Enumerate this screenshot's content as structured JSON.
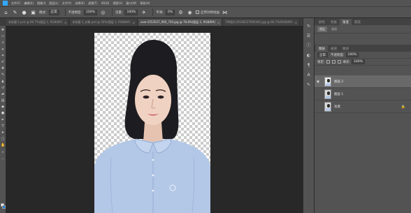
{
  "menubar": {
    "items": [
      "文件(F)",
      "编辑(E)",
      "图像(I)",
      "图层(L)",
      "文字(Y)",
      "选择(S)",
      "滤镜(T)",
      "3D(D)",
      "视图(V)",
      "窗口(W)",
      "帮助(H)"
    ]
  },
  "options": {
    "mode_label": "模式:",
    "mode_value": "正常",
    "opacity_label": "不透明度:",
    "opacity_value": "100%",
    "flow_label": "流量:",
    "flow_value": "100%",
    "smooth_label": "平滑:",
    "smooth_value": "0%",
    "symmetry_label": "启用对称绘画"
  },
  "tabs": [
    {
      "label": "未标题-1.psd @ 66.7%(图层 1, RGB/8#)"
    },
    {
      "label": "未标题-1_对象.psd @ 50%(图层 1, RGB/8#)"
    },
    {
      "label": "user-2553527_960_720.jpg @ 78.8%(图层 2, RGB/8#)"
    },
    {
      "label": "TIM图片20180227095445.jpg @ 66.7%(RGB/8#)"
    }
  ],
  "panels": {
    "top_tabs": [
      "颜色",
      "色板",
      "渐变",
      "图案"
    ],
    "top_active": "渐变",
    "sub_buttons": [
      "图层",
      "通道"
    ],
    "layers_tabs": [
      "图层",
      "通道",
      "路径"
    ],
    "blend_mode": "正常",
    "opacity_label": "不透明度:",
    "opacity_value": "100%",
    "lock_label": "锁定:",
    "fill_label": "填充:",
    "fill_value": "100%",
    "layers": [
      {
        "name": "图层 2",
        "selected": true,
        "visible": true
      },
      {
        "name": "图层 1",
        "selected": false,
        "visible": false
      },
      {
        "name": "背景",
        "selected": false,
        "visible": false,
        "locked": true
      }
    ]
  },
  "colors": {
    "foreground": "#ffffff",
    "background": "#1c7fd8",
    "shirt": "#b3c7e7"
  }
}
